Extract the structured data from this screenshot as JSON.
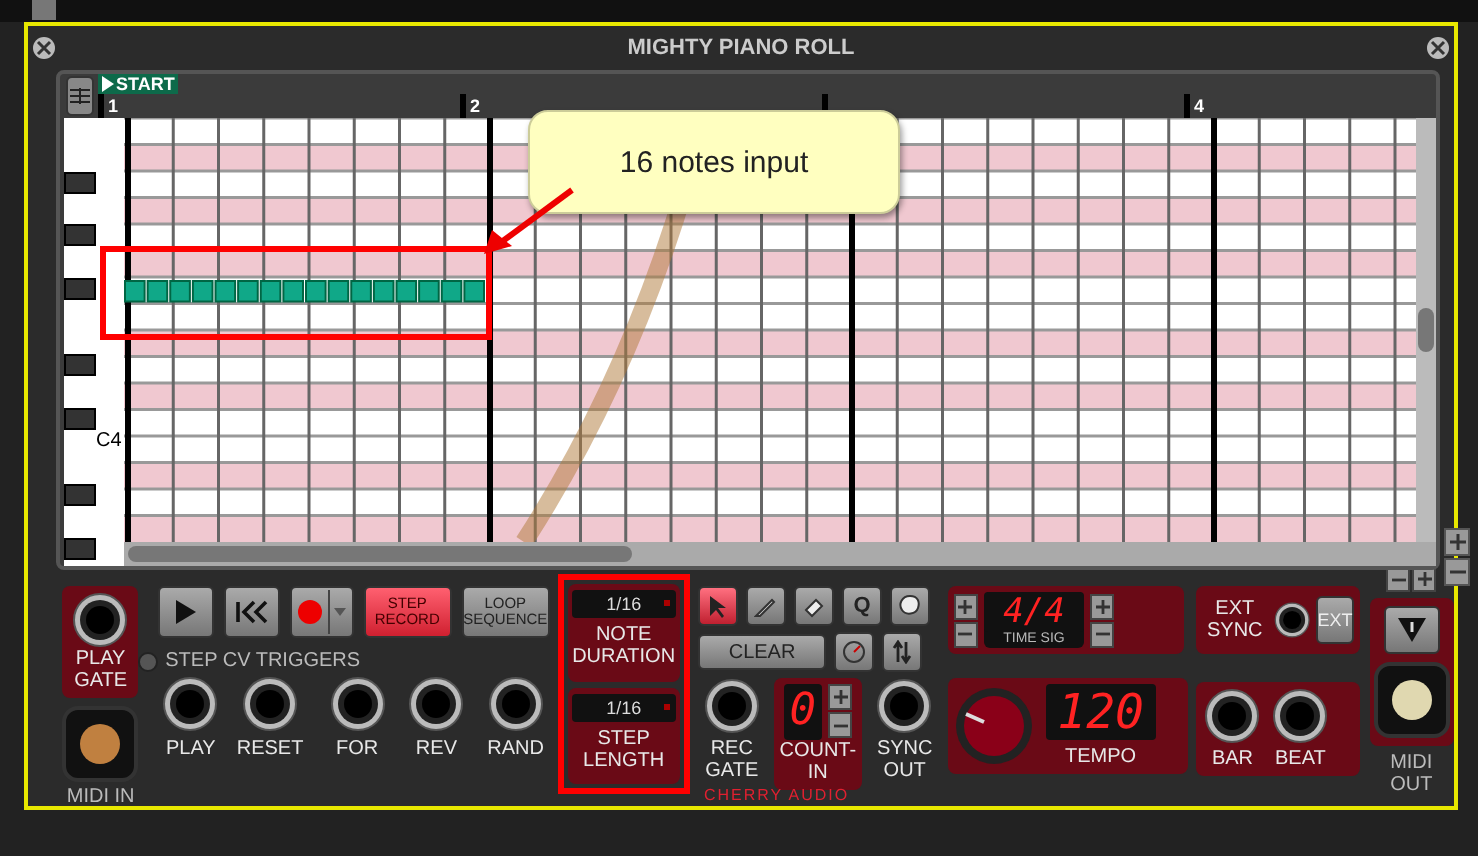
{
  "window": {
    "title": "MIGHTY PIANO ROLL"
  },
  "piano_roll": {
    "start_marker": "START",
    "bars": [
      {
        "kind": "labeled",
        "label": "1"
      },
      {
        "kind": "labeled",
        "label": "2"
      },
      {
        "kind": "covered"
      },
      {
        "kind": "labeled",
        "label": "4"
      }
    ],
    "key_label": "C4",
    "notes": [
      {
        "kind": "step"
      },
      {
        "kind": "step"
      },
      {
        "kind": "step"
      },
      {
        "kind": "step"
      },
      {
        "kind": "step"
      },
      {
        "kind": "step"
      },
      {
        "kind": "step"
      },
      {
        "kind": "step"
      },
      {
        "kind": "step"
      },
      {
        "kind": "step"
      },
      {
        "kind": "step"
      },
      {
        "kind": "step"
      },
      {
        "kind": "step"
      },
      {
        "kind": "step"
      },
      {
        "kind": "step"
      },
      {
        "kind": "step"
      }
    ]
  },
  "annotation": {
    "text": "16 notes input"
  },
  "transport": {
    "play_gate": "PLAY GATE",
    "step_record": {
      "label": "STEP RECORD",
      "on": true
    },
    "loop_sequence": {
      "label": "LOOP SEQUENCE",
      "on": false
    }
  },
  "step_cv_triggers": {
    "title": "STEP CV TRIGGERS",
    "jacks": [
      "PLAY",
      "RESET",
      "FOR",
      "REV",
      "RAND"
    ]
  },
  "midi_in": "MIDI IN",
  "note_duration": {
    "value": "1/16",
    "label": "NOTE DURATION"
  },
  "step_length": {
    "value": "1/16",
    "label": "STEP LENGTH"
  },
  "tools": [
    {
      "kind": "select",
      "selected": true
    },
    {
      "kind": "pencil",
      "selected": false
    },
    {
      "kind": "eraser",
      "selected": false
    },
    {
      "kind": "quantize",
      "label": "Q",
      "selected": false
    },
    {
      "kind": "lasso",
      "selected": false
    }
  ],
  "clear": "CLEAR",
  "rec_gate": "REC GATE",
  "count_in": {
    "value": "0",
    "label": "COUNT-IN"
  },
  "sync_out": "SYNC OUT",
  "time_sig": {
    "value": "4/4",
    "label": "TIME SIG"
  },
  "tempo": {
    "value": "120",
    "label": "TEMPO"
  },
  "ext_sync": {
    "label": "EXT SYNC",
    "button": "EXT"
  },
  "bar": "BAR",
  "beat": "BEAT",
  "midi_out": "MIDI OUT",
  "brand": "CHERRY AUDIO"
}
